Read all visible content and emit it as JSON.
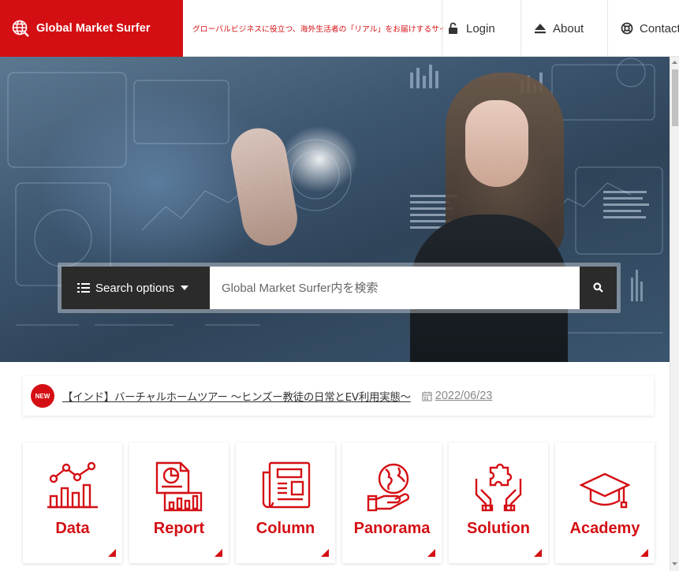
{
  "header": {
    "logo_text": "Global Market Surfer",
    "tagline": "グローバルビジネスに役立つ、海外生活者の「リアル」をお届けするサイト",
    "nav": {
      "login": "Login",
      "about": "About",
      "contact": "Contact"
    }
  },
  "search": {
    "options_label": "Search options",
    "placeholder": "Global Market Surfer内を検索"
  },
  "news": {
    "badge": "NEW",
    "title": "【インド】バーチャルホームツアー ～ヒンズー教徒の日常とEV利用実態～",
    "date": "2022/06/23"
  },
  "categories": [
    {
      "label": "Data",
      "icon": "data-chart-icon"
    },
    {
      "label": "Report",
      "icon": "report-document-icon"
    },
    {
      "label": "Column",
      "icon": "newspaper-icon"
    },
    {
      "label": "Panorama",
      "icon": "globe-hand-icon"
    },
    {
      "label": "Solution",
      "icon": "puzzle-hands-icon"
    },
    {
      "label": "Academy",
      "icon": "graduation-cap-icon"
    }
  ],
  "colors": {
    "brand_red": "#d40f14",
    "dark": "#2b2b2b"
  }
}
